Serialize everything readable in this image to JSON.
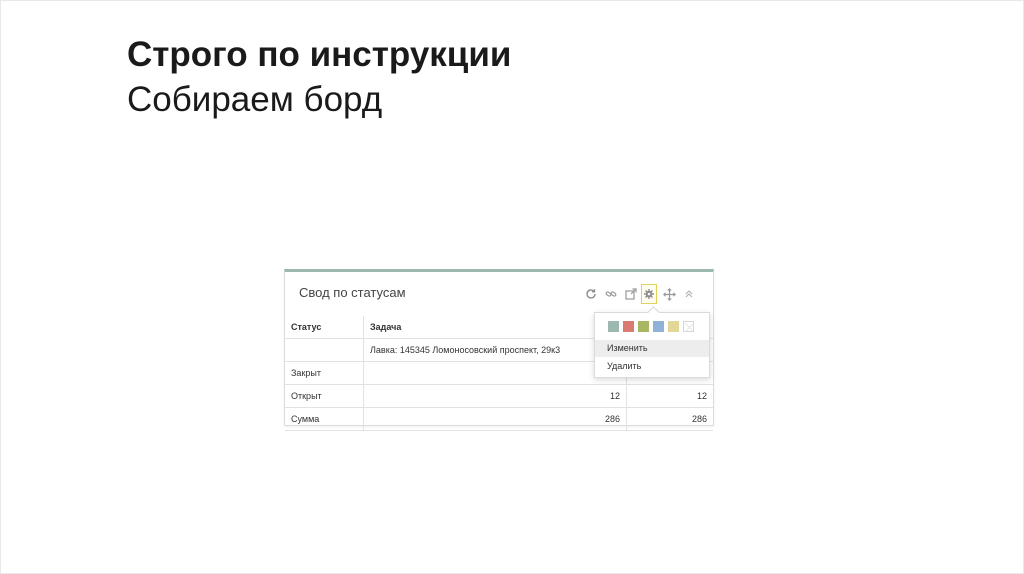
{
  "slide": {
    "title": "Строго по инструкции",
    "subtitle": "Собираем борд"
  },
  "widget": {
    "title": "Свод по статусам",
    "accent_color": "#9cb8b1",
    "tools": [
      "refresh-icon",
      "link-icon",
      "external-link-icon",
      "gear-icon",
      "move-icon",
      "collapse-icon"
    ],
    "table": {
      "headers": {
        "status": "Статус",
        "task": "Задача"
      },
      "subheader_task": "Лавка: 145345 Ломоносовский проспект, 29к3",
      "rows": [
        {
          "status": "Закрыт",
          "v1": "",
          "v2": ""
        },
        {
          "status": "Открыт",
          "v1": "12",
          "v2": "12"
        },
        {
          "status": "Сумма",
          "v1": "286",
          "v2": "286"
        }
      ]
    }
  },
  "settings_menu": {
    "swatch_colors": [
      "#9cb8b1",
      "#d97b72",
      "#a9b664",
      "#8fb3d6",
      "#e3d699"
    ],
    "items": [
      {
        "label": "Изменить"
      },
      {
        "label": "Удалить"
      }
    ]
  }
}
